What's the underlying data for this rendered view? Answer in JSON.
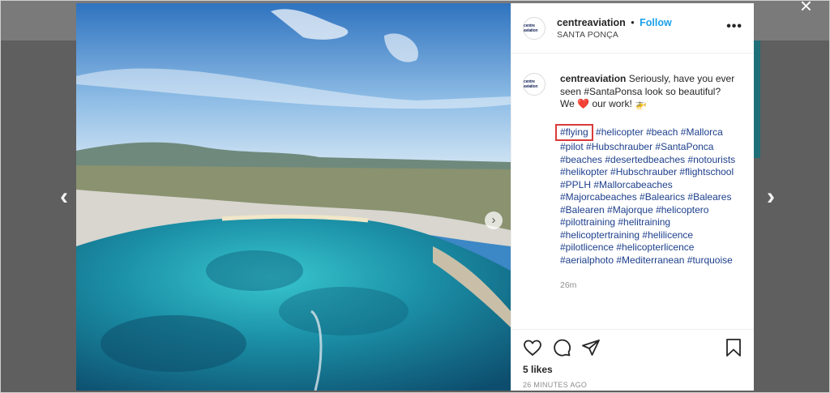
{
  "post": {
    "username": "centreaviation",
    "separator": "•",
    "follow_label": "Follow",
    "location": "SANTA PONÇA",
    "avatar_logo": "centre aviation",
    "more_label": "•••",
    "caption_text": "Seriously, have you ever seen #SantaPonsa look so beautiful?",
    "caption_line2_prefix": "We",
    "caption_line2_suffix": "our work!",
    "heart_emoji": "❤️",
    "helicopter_emoji": "🚁",
    "highlighted_tag": "#flying",
    "hashtags": "#helicopter #beach #Mallorca #pilot #Hubschrauber #SantaPonca #beaches #desertedbeaches #notourists #helikopter #Hubschrauber #flightschool #PPLH #Mallorcabeaches #Majorcabeaches #Balearics #Baleares #Balearen #Majorque #helicoptero #pilottraining #helitraining #helicoptertraining #helilicence #pilotlicence #helicopterlicence #aerialphoto #Mediterranean #turquoise",
    "time_short": "26m",
    "likes": "5 likes",
    "time_ago": "26 MINUTES AGO"
  },
  "nav": {
    "prev_arrow": "‹",
    "next_arrow": "›",
    "close_label": "×",
    "carousel_next": "›"
  },
  "colors": {
    "follow": "#1aa0e8",
    "hashtag": "#1d3f8c",
    "highlight_box": "#d93b3b"
  },
  "icons": [
    "like-heart-icon",
    "comment-icon",
    "share-icon",
    "save-bookmark-icon"
  ]
}
